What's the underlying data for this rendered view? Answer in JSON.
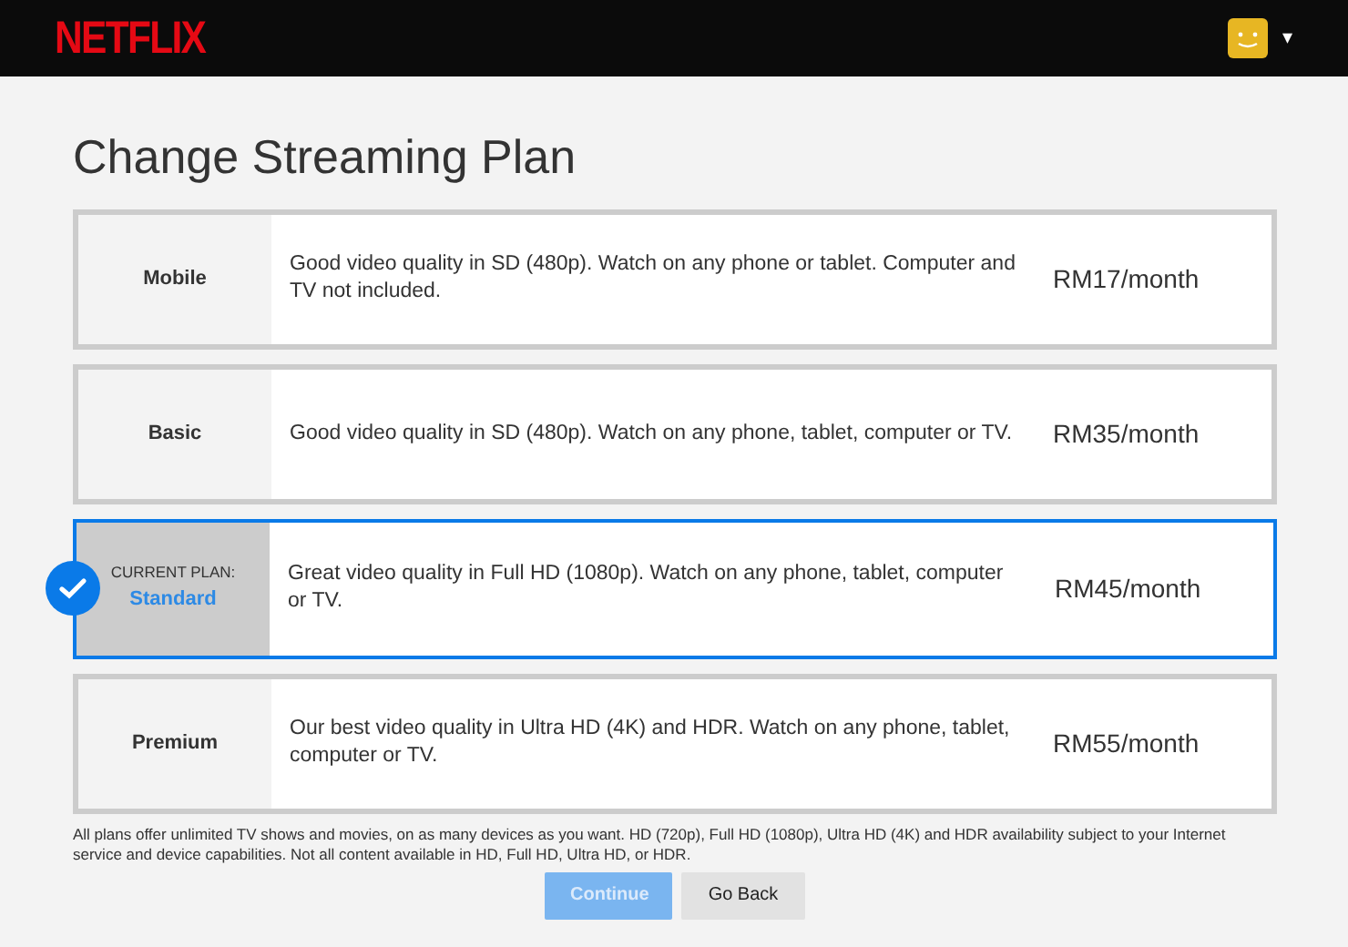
{
  "header": {
    "logo": "NETFLIX",
    "menu_caret": "▾"
  },
  "title": "Change Streaming Plan",
  "plans": [
    {
      "name": "Mobile",
      "description": "Good video quality in SD (480p). Watch on any phone or tablet. Computer and TV not included.",
      "price": "RM17/month",
      "selected": false
    },
    {
      "name": "Basic",
      "description": "Good video quality in SD (480p). Watch on any phone, tablet, computer or TV.",
      "price": "RM35/month",
      "selected": false
    },
    {
      "name": "Standard",
      "current_label": "CURRENT PLAN:",
      "description": "Great video quality in Full HD (1080p). Watch on any phone, tablet, computer or TV.",
      "price": "RM45/month",
      "selected": true
    },
    {
      "name": "Premium",
      "description": "Our best video quality in Ultra HD (4K) and HDR. Watch on any phone, tablet, computer or TV.",
      "price": "RM55/month",
      "selected": false
    }
  ],
  "footnote": "All plans offer unlimited TV shows and movies, on as many devices as you want. HD (720p), Full HD (1080p), Ultra HD (4K) and HDR availability subject to your Internet service and device capabilities. Not all content available in HD, Full HD, Ultra HD, or HDR.",
  "buttons": [
    {
      "label": "Continue",
      "kind": "primary",
      "disabled": true
    },
    {
      "label": "Go Back",
      "kind": "secondary",
      "disabled": false
    }
  ]
}
